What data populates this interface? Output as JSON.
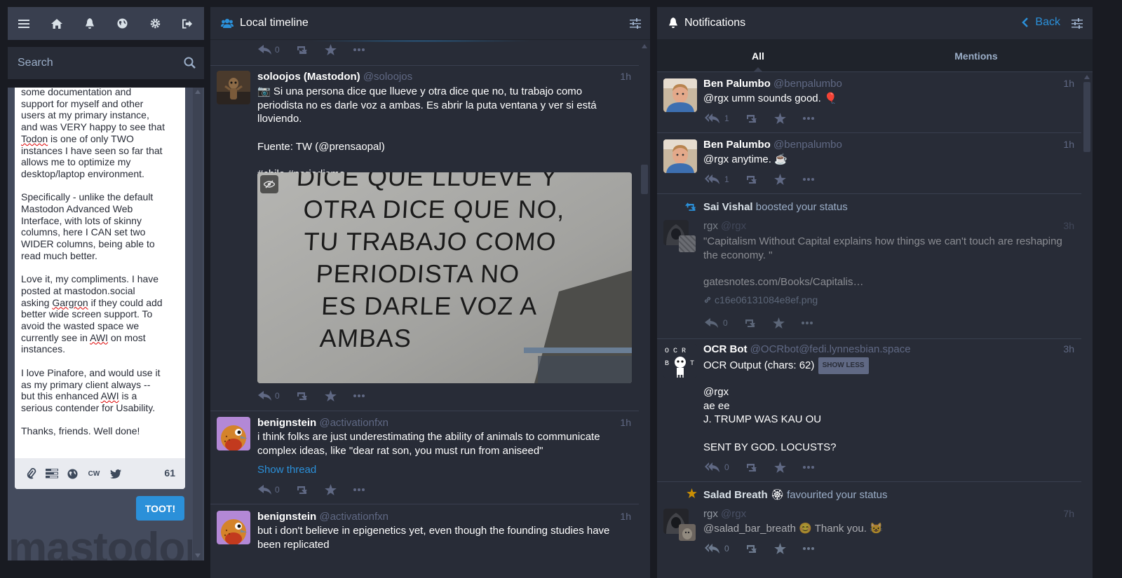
{
  "drawer": {
    "search_placeholder": "Search",
    "compose": {
      "paragraphs": [
        [
          "some documentation and support for myself and other users at my primary instance, and was VERY happy to see that ",
          {
            "sp": "Todon"
          },
          " is one of only TWO instances I have seen so far that allows me to optimize my desktop/laptop environment."
        ],
        [
          "Specifically - unlike the default Mastodon Advanced Web Interface, with lots of skinny columns, here I CAN set two WIDER columns, being able to read much better."
        ],
        [
          "Love it, my compliments. I have posted at mastodon.social asking ",
          {
            "sp": "Gargron"
          },
          " if they could add better wide screen support. To avoid the wasted space we currently see in ",
          {
            "sp": "AWI"
          },
          " on most instances."
        ],
        [
          "I love Pinafore, and would use it as my primary client always -- but this enhanced ",
          {
            "sp": "AWI"
          },
          " is a serious contender for Usability."
        ],
        [
          "Thanks, friends. Well done!"
        ]
      ],
      "cw_label": "CW",
      "char_count": "61",
      "toot_label": "TOOT!"
    },
    "watermark": "mastodon"
  },
  "timeline": {
    "title": "Local timeline",
    "top_reply_count": "0",
    "posts": [
      {
        "name": "soloojos (Mastodon)",
        "acct": "@soloojos",
        "time": "1h",
        "paragraphs": [
          "📷 Si una persona dice que llueve y otra dice que no, tu trabajo como periodista no es darle voz a ambas. Es abrir la puta ventana y ver si está lloviendo.",
          "Fuente: TW (@prensaopal)",
          "#chile #periodismo"
        ],
        "image_text": [
          "DICE QUE LLUEVE Y",
          "OTRA DICE QUE NO,",
          "TU TRABAJO COMO",
          "PERIODISTA NO",
          "ES DARLE VOZ A",
          "AMBAS"
        ],
        "reply_count": "0"
      },
      {
        "name": "benignstein",
        "acct": "@activationfxn",
        "time": "1h",
        "text": "i think folks are just underestimating the ability of animals to communicate complex ideas, like \"dear rat son, you must run from aniseed\"",
        "show_thread": "Show thread",
        "reply_count": "0"
      },
      {
        "name": "benignstein",
        "acct": "@activationfxn",
        "time": "1h",
        "text": "but i don't believe in epigenetics yet, even though the founding studies have been replicated"
      }
    ]
  },
  "notifications": {
    "title": "Notifications",
    "back_label": "Back",
    "tabs": [
      "All",
      "Mentions"
    ],
    "items": [
      {
        "name": "Ben Palumbo",
        "acct": "@benpalumbo",
        "time": "1h",
        "mention": "@rgx",
        "text": " umm sounds good. 🎈",
        "reply_count": "1"
      },
      {
        "name": "Ben Palumbo",
        "acct": "@benpalumbo",
        "time": "1h",
        "mention": "@rgx",
        "text": " anytime. ☕",
        "reply_count": "1"
      },
      {
        "booster": "Sai Vishal",
        "boost_text": "boosted your status",
        "name": "rgx",
        "acct": "@rgx",
        "time": "3h",
        "text": "\"Capitalism Without Capital explains how things we can't touch are reshaping the economy. \"",
        "link": "gatesnotes.com/Books/Capitalis…",
        "attachment": "c16e06131084e8ef.png",
        "reply_count": "0"
      },
      {
        "name": "OCR Bot",
        "acct": "@OCRbot@fedi.lynnesbian.space",
        "time": "3h",
        "cw": "OCR Output (chars: 62)",
        "cw_button": "SHOW LESS",
        "lines": [
          "@rgx",
          "ae ee",
          "J. TRUMP WAS KAU OU",
          "",
          "SENT BY GOD. LOCUSTS?"
        ],
        "reply_count": "0"
      },
      {
        "favouriter": "Salad Breath",
        "fav_emoji": "🏵",
        "fav_text": "favourited your status",
        "name": "rgx",
        "acct": "@rgx",
        "time": "7h",
        "mention": "@salad_bar_breath",
        "text": " 😊 Thank you. 😺",
        "reply_count": "0"
      }
    ]
  },
  "colors": {
    "accent": "#2b90d9",
    "column_bg": "#282c37",
    "page_bg": "#191b22",
    "muted": "#606984",
    "fav": "#ca8f04"
  }
}
